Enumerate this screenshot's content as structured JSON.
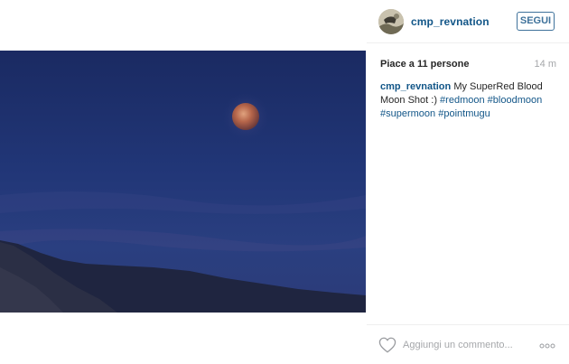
{
  "post": {
    "username": "cmp_revnation",
    "follow_label": "SEGUI",
    "likes_text": "Piace a 11 persone",
    "time_ago": "14 m",
    "caption": {
      "username": "cmp_revnation",
      "text": "My SuperRed Blood Moon Shot :)",
      "hashtags": [
        "#redmoon",
        "#bloodmoon",
        "#supermoon",
        "#pointmugu"
      ]
    },
    "comment_placeholder": "Aggiungi un commento...",
    "icons": {
      "like": "heart-outline-icon",
      "more": "ellipsis-icon"
    },
    "colors": {
      "link": "#125688",
      "follow": "#3f729b",
      "muted": "#a5a7aa"
    }
  }
}
